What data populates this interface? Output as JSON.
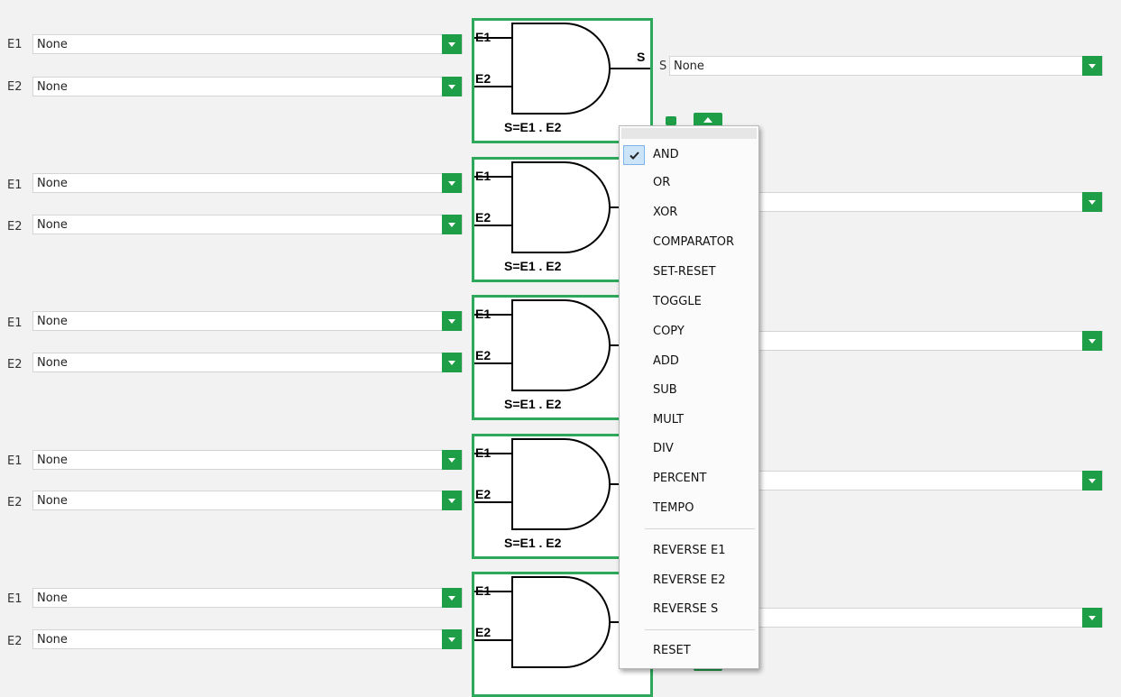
{
  "rows": [
    {
      "e1_label": "E1",
      "e1_value": "None",
      "e2_label": "E2",
      "e2_value": "None",
      "gate_e1": "E1",
      "gate_e2": "E2",
      "gate_s": "S",
      "formula": "S=E1 . E2",
      "s_label": "S",
      "s_value": "None"
    },
    {
      "e1_label": "E1",
      "e1_value": "None",
      "e2_label": "E2",
      "e2_value": "None",
      "gate_e1": "E1",
      "gate_e2": "E2",
      "formula": "S=E1 . E2"
    },
    {
      "e1_label": "E1",
      "e1_value": "None",
      "e2_label": "E2",
      "e2_value": "None",
      "gate_e1": "E1",
      "gate_e2": "E2",
      "formula": "S=E1 . E2"
    },
    {
      "e1_label": "E1",
      "e1_value": "None",
      "e2_label": "E2",
      "e2_value": "None",
      "gate_e1": "E1",
      "gate_e2": "E2",
      "formula": "S=E1 . E2"
    },
    {
      "e1_label": "E1",
      "e1_value": "None",
      "e2_label": "E2",
      "e2_value": "None",
      "gate_e1": "E1",
      "gate_e2": "E2"
    }
  ],
  "menu": {
    "items": [
      {
        "label": "AND",
        "checked": true
      },
      {
        "label": "OR"
      },
      {
        "label": "XOR"
      },
      {
        "label": "COMPARATOR"
      },
      {
        "label": "SET-RESET"
      },
      {
        "label": "TOGGLE"
      },
      {
        "label": "COPY"
      },
      {
        "label": "ADD"
      },
      {
        "label": "SUB"
      },
      {
        "label": "MULT"
      },
      {
        "label": "DIV"
      },
      {
        "label": "PERCENT"
      },
      {
        "label": "TEMPO"
      },
      {
        "label": "REVERSE E1"
      },
      {
        "label": "REVERSE E2"
      },
      {
        "label": "REVERSE S"
      },
      {
        "label": "RESET"
      }
    ]
  },
  "colors": {
    "accent": "#1f9e48",
    "gate_border": "#2ea85a",
    "check_bg": "#cce4f7"
  },
  "icons": {
    "dropdown": "chevron-down-icon",
    "check": "checkmark-icon",
    "gate": "and-gate-icon"
  }
}
